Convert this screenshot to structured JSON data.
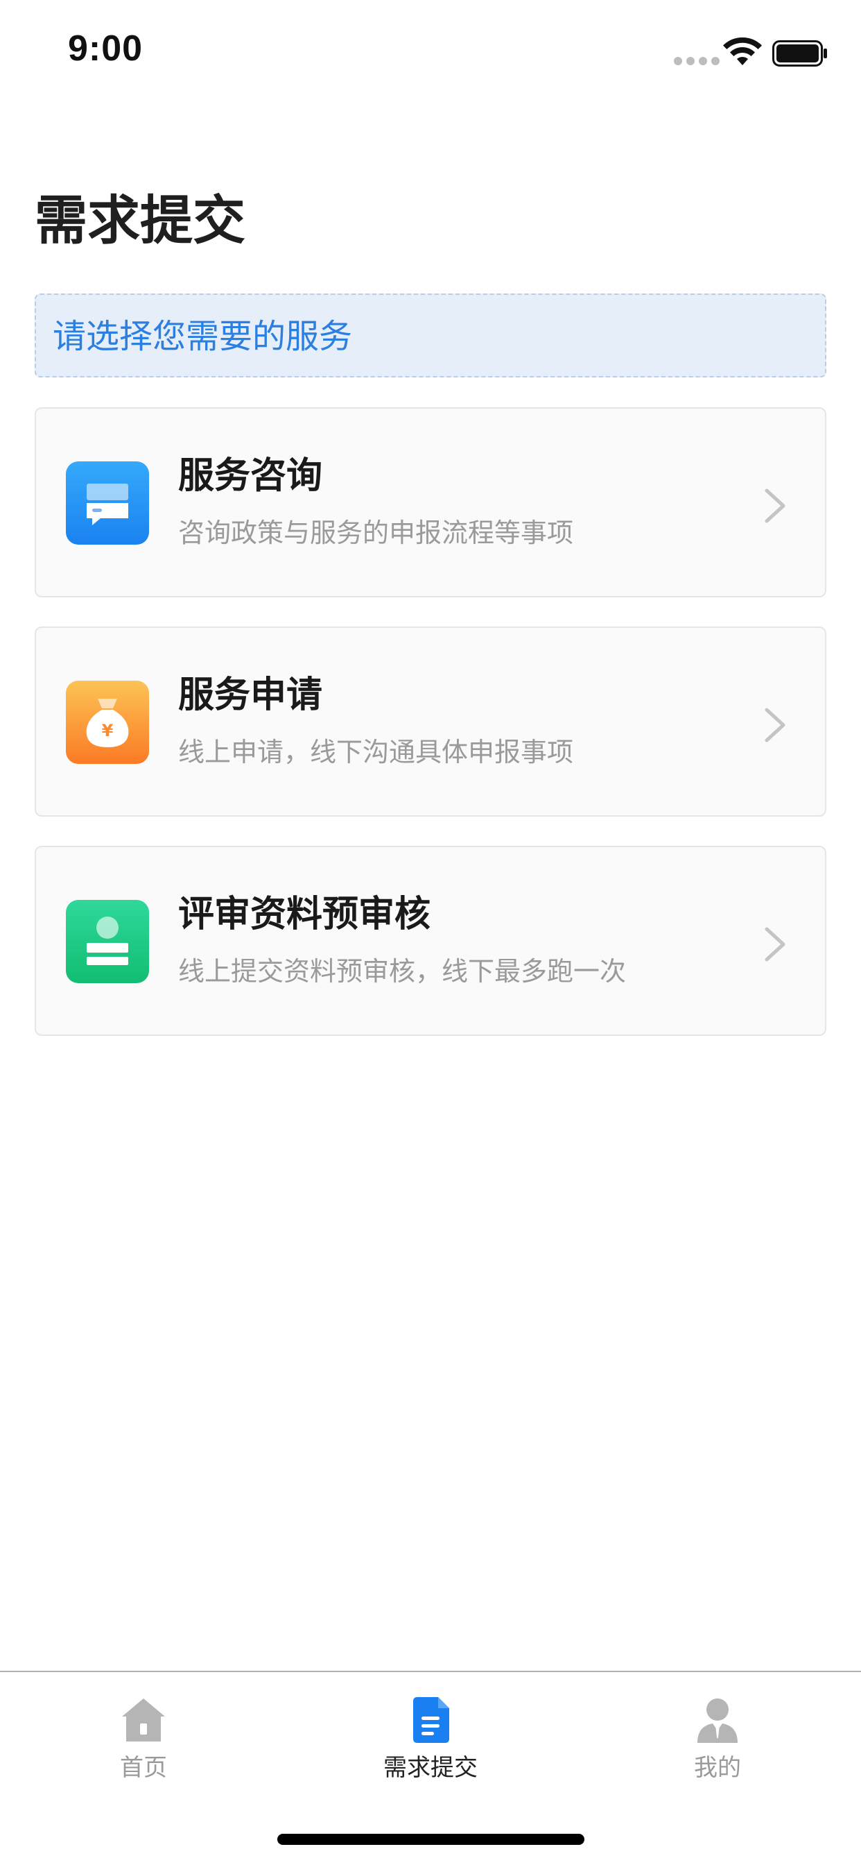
{
  "status_bar": {
    "time": "9:00"
  },
  "header": {
    "title": "需求提交"
  },
  "notice": {
    "text": "请选择您需要的服务"
  },
  "services": [
    {
      "title": "服务咨询",
      "desc": "咨询政策与服务的申报流程等事项",
      "icon": "chat-icon",
      "color": "#2f8ff5"
    },
    {
      "title": "服务申请",
      "desc": "线上申请，线下沟通具体申报事项",
      "icon": "money-bag-icon",
      "color": "#fb8a2e"
    },
    {
      "title": "评审资料预审核",
      "desc": "线上提交资料预审核，线下最多跑一次",
      "icon": "id-card-icon",
      "color": "#1fc780"
    }
  ],
  "tab_bar": {
    "items": [
      {
        "label": "首页",
        "icon": "home-icon",
        "active": false
      },
      {
        "label": "需求提交",
        "icon": "document-icon",
        "active": true
      },
      {
        "label": "我的",
        "icon": "user-icon",
        "active": false
      }
    ],
    "active_color": "#1a7ff0",
    "inactive_color": "#9a9a9a"
  }
}
